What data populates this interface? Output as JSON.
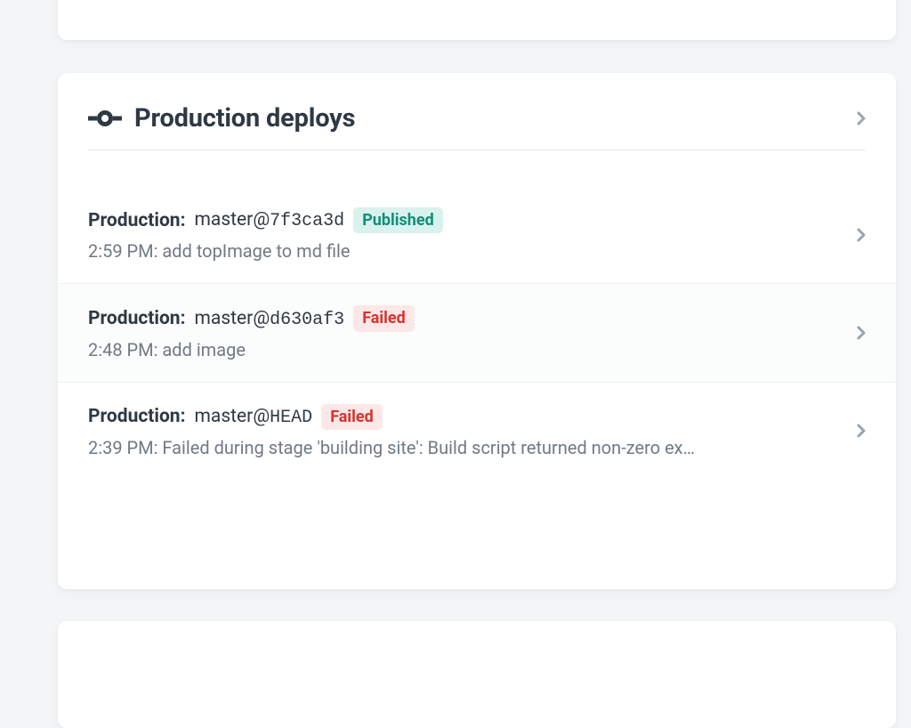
{
  "section": {
    "title": "Production deploys"
  },
  "deploys": [
    {
      "env": "Production",
      "branch": "master",
      "hash": "7f3ca3d",
      "status": "Published",
      "status_kind": "published",
      "time": "2:59 PM",
      "message": "add topImage to md file"
    },
    {
      "env": "Production",
      "branch": "master",
      "hash": "d630af3",
      "status": "Failed",
      "status_kind": "failed",
      "time": "2:48 PM",
      "message": "add image"
    },
    {
      "env": "Production",
      "branch": "master",
      "hash": "HEAD",
      "status": "Failed",
      "status_kind": "failed",
      "time": "2:39 PM",
      "message": "Failed during stage 'building site': Build script returned non-zero ex…"
    }
  ]
}
